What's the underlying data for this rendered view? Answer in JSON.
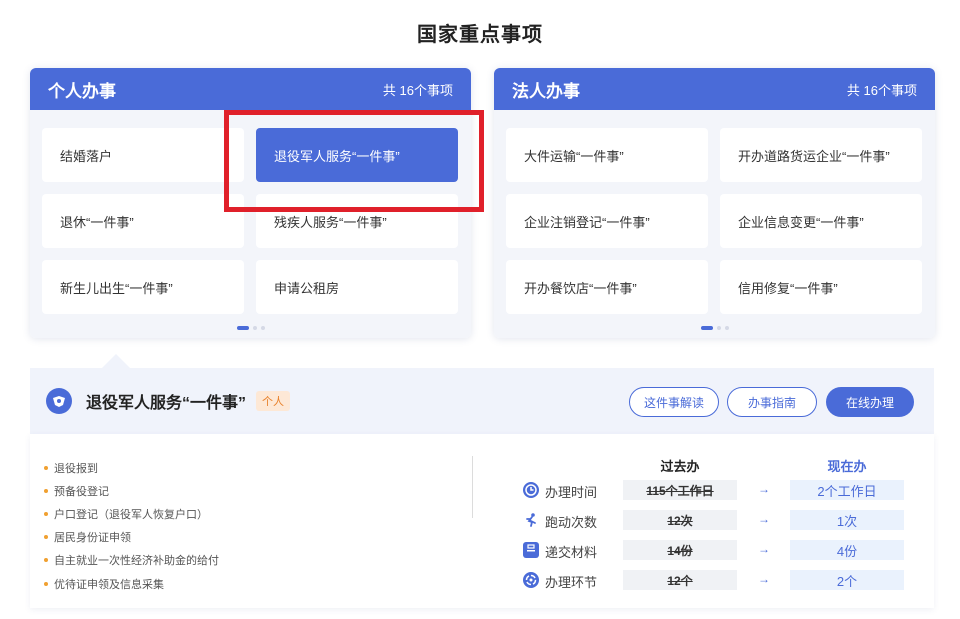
{
  "page_title": "国家重点事项",
  "personal": {
    "title": "个人办事",
    "count": "共 16个事项",
    "items": [
      {
        "label": "结婚落户"
      },
      {
        "label": "退役军人服务“一件事”"
      },
      {
        "label": "退休“一件事”"
      },
      {
        "label": "残疾人服务“一件事”"
      },
      {
        "label": "新生儿出生“一件事”"
      },
      {
        "label": "申请公租房"
      }
    ],
    "selected_index": 1
  },
  "legal": {
    "title": "法人办事",
    "count": "共 16个事项",
    "items": [
      {
        "label": "大件运输“一件事”"
      },
      {
        "label": "开办道路货运企业“一件事”"
      },
      {
        "label": "企业注销登记“一件事”"
      },
      {
        "label": "企业信息变更“一件事”"
      },
      {
        "label": "开办餐饮店“一件事”"
      },
      {
        "label": "信用修复“一件事”"
      }
    ]
  },
  "detail": {
    "title": "退役军人服务“一件事”",
    "tag": "个人",
    "buttons": {
      "explain": "这件事解读",
      "guide": "办事指南",
      "online": "在线办理"
    },
    "steps": [
      "退役报到",
      "预备役登记",
      "户口登记（退役军人恢复户口）",
      "居民身份证申领",
      "自主就业一次性经济补助金的给付",
      "优待证申领及信息采集"
    ],
    "compare": {
      "past_label": "过去办",
      "now_label": "现在办",
      "arrow": "→",
      "rows": [
        {
          "icon": "clock-icon",
          "label": "办理时间",
          "old": "115个工作日",
          "new": "2个工作日"
        },
        {
          "icon": "running-person-icon",
          "label": "跑动次数",
          "old": "12次",
          "new": "1次"
        },
        {
          "icon": "briefcase-icon",
          "label": "递交材料",
          "old": "14份",
          "new": "4份"
        },
        {
          "icon": "cycle-icon",
          "label": "办理环节",
          "old": "12个",
          "new": "2个"
        }
      ]
    }
  },
  "colors": {
    "brand_blue": "#4a6bd8",
    "highlight_red": "#e0202a",
    "tag_orange": "#e8802a",
    "bullet_orange": "#f0a030"
  }
}
